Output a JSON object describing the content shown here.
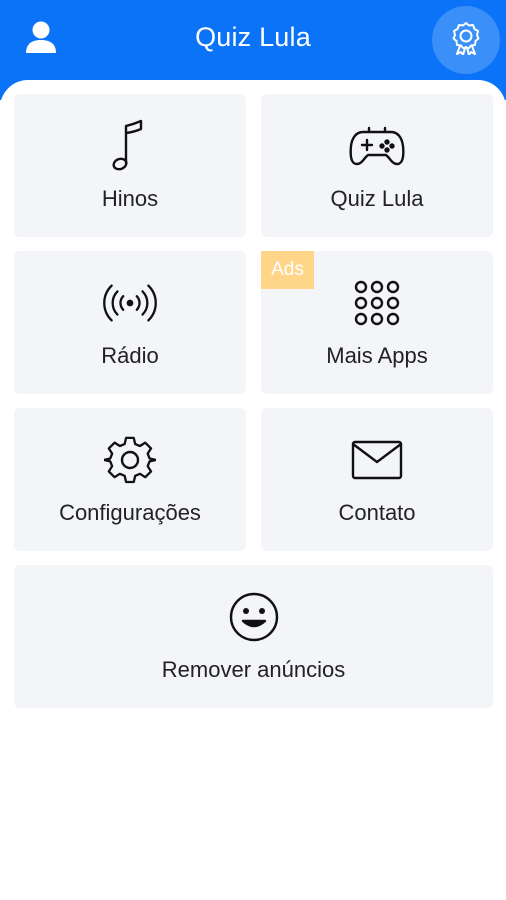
{
  "header": {
    "title": "Quiz Lula",
    "profile_icon": "user-icon",
    "award_icon": "award-ribbon-icon",
    "color": "#0a73f7"
  },
  "tiles": [
    {
      "label": "Hinos",
      "icon": "music-note-icon"
    },
    {
      "label": "Quiz Lula",
      "icon": "gamepad-icon"
    },
    {
      "label": "Rádio",
      "icon": "radio-broadcast-icon"
    },
    {
      "label": "Mais Apps",
      "icon": "grid-dots-icon",
      "badge": "Ads"
    },
    {
      "label": "Configurações",
      "icon": "gear-icon"
    },
    {
      "label": "Contato",
      "icon": "envelope-icon"
    },
    {
      "label": "Remover anúncios",
      "icon": "smiley-icon"
    }
  ],
  "colors": {
    "tile_bg": "#f3f5f8",
    "badge_bg": "#ffd58a"
  }
}
